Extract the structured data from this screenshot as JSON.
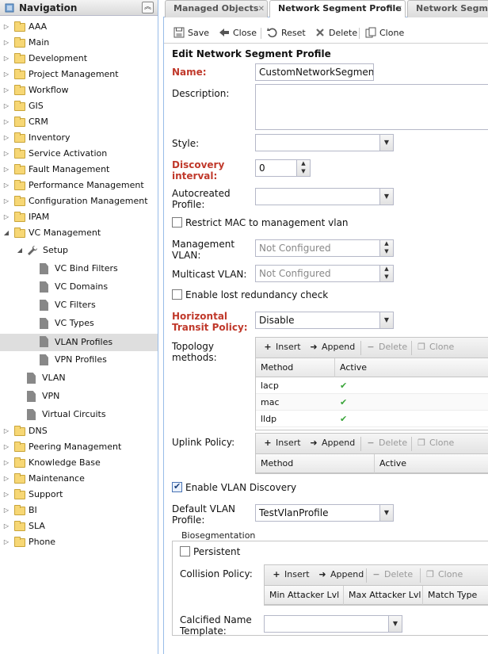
{
  "nav": {
    "title": "Navigation",
    "items": [
      {
        "label": "AAA"
      },
      {
        "label": "Main"
      },
      {
        "label": "Development"
      },
      {
        "label": "Project Management"
      },
      {
        "label": "Workflow"
      },
      {
        "label": "GIS"
      },
      {
        "label": "CRM"
      },
      {
        "label": "Inventory"
      },
      {
        "label": "Service Activation"
      },
      {
        "label": "Fault Management"
      },
      {
        "label": "Performance Management"
      },
      {
        "label": "Configuration Management"
      },
      {
        "label": "IPAM"
      },
      {
        "label": "VC Management"
      },
      {
        "label": "Setup"
      },
      {
        "label": "VC Bind Filters"
      },
      {
        "label": "VC Domains"
      },
      {
        "label": "VC Filters"
      },
      {
        "label": "VC Types"
      },
      {
        "label": "VLAN Profiles"
      },
      {
        "label": "VPN Profiles"
      },
      {
        "label": "VLAN"
      },
      {
        "label": "VPN"
      },
      {
        "label": "Virtual Circuits"
      },
      {
        "label": "DNS"
      },
      {
        "label": "Peering Management"
      },
      {
        "label": "Knowledge Base"
      },
      {
        "label": "Maintenance"
      },
      {
        "label": "Support"
      },
      {
        "label": "BI"
      },
      {
        "label": "SLA"
      },
      {
        "label": "Phone"
      }
    ]
  },
  "tabs": [
    {
      "label": "Managed Objects"
    },
    {
      "label": "Network Segment Profile"
    },
    {
      "label": "Network Segme"
    }
  ],
  "toolbar": {
    "save": "Save",
    "close": "Close",
    "reset": "Reset",
    "delete": "Delete",
    "clone": "Clone"
  },
  "form": {
    "title": "Edit Network Segment Profile",
    "name_label": "Name:",
    "name_value": "CustomNetworkSegmentPr",
    "description_label": "Description:",
    "style_label": "Style:",
    "discovery_label_1": "Discovery",
    "discovery_label_2": "interval:",
    "discovery_value": "0",
    "autocreated_label_1": "Autocreated",
    "autocreated_label_2": "Profile:",
    "restrict_mac_label": "Restrict MAC to management vlan",
    "mgmt_vlan_label_1": "Management",
    "mgmt_vlan_label_2": "VLAN:",
    "mgmt_vlan_placeholder": "Not Configured",
    "multicast_vlan_label": "Multicast VLAN:",
    "multicast_vlan_placeholder": "Not Configured",
    "lost_redundancy_label": "Enable lost redundancy check",
    "horizontal_label_1": "Horizontal",
    "horizontal_label_2": "Transit Policy:",
    "horizontal_value": "Disable",
    "topology_label_1": "Topology",
    "topology_label_2": "methods:",
    "uplink_label": "Uplink Policy:",
    "enable_vlan_discovery_label": "Enable VLAN Discovery",
    "default_vlan_label_1": "Default VLAN",
    "default_vlan_label_2": "Profile:",
    "default_vlan_value": "TestVlanProfile",
    "bioseg_legend": "Biosegmentation",
    "persistent_label": "Persistent",
    "collision_label": "Collision Policy:",
    "calcified_label_1": "Calcified Name",
    "calcified_label_2": "Template:"
  },
  "grid_buttons": {
    "insert": "Insert",
    "append": "Append",
    "delete": "Delete",
    "clone": "Clone"
  },
  "topology_grid": {
    "columns": [
      "Method",
      "Active"
    ],
    "rows": [
      {
        "method": "lacp",
        "active": "✔"
      },
      {
        "method": "mac",
        "active": "✔"
      },
      {
        "method": "lldp",
        "active": "✔"
      }
    ]
  },
  "uplink_grid": {
    "columns": [
      "Method",
      "Active"
    ]
  },
  "collision_grid": {
    "columns": [
      "Min Attacker Lvl",
      "Max Attacker Lvl",
      "Match Type"
    ]
  }
}
